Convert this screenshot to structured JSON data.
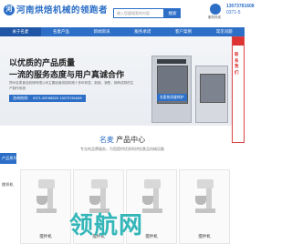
{
  "header": {
    "logo_mark": "河",
    "logo_text": "河南烘焙机械的领跑者",
    "search_placeholder": "输入您要搜索的内容",
    "search_button": "搜索",
    "phone_label": "服务热线",
    "phone_1": "13073781608",
    "phone_2": "0371-5"
  },
  "nav": {
    "items": [
      {
        "label": "关于名麦",
        "active": true
      },
      {
        "label": "名麦产品",
        "active": false
      },
      {
        "label": "新闻资讯",
        "active": false
      },
      {
        "label": "服务承诺",
        "active": false
      },
      {
        "label": "客户案例",
        "active": false
      },
      {
        "label": "常见问题",
        "active": false
      }
    ]
  },
  "banner": {
    "headline_1": "以优质的产品质量",
    "headline_2": "一流的服务态度与用户真诚合作",
    "description": "郑州名麦食品机械有限公司主要经营烘焙机械十多年研发、制造、销售，拥有成熟的生产制作系统",
    "tel_label": "咨询热线：",
    "tel_numbers": "0371-55768520  13073781608",
    "product_badge": "名麦热风旋转炉"
  },
  "float_widget": {
    "text": "联系我们"
  },
  "products": {
    "title_highlight": "名麦",
    "title_rest": "产品中心",
    "subtitle": "专业的品牌服务，为您提供优质的烘焙食品机械设备",
    "category_label": "产品系列",
    "side_item": "搅拌机",
    "items": [
      {
        "label": "搅拌机"
      },
      {
        "label": "搅拌机"
      },
      {
        "label": "搅拌机"
      },
      {
        "label": "搅拌机"
      }
    ]
  },
  "watermark": "领航网"
}
